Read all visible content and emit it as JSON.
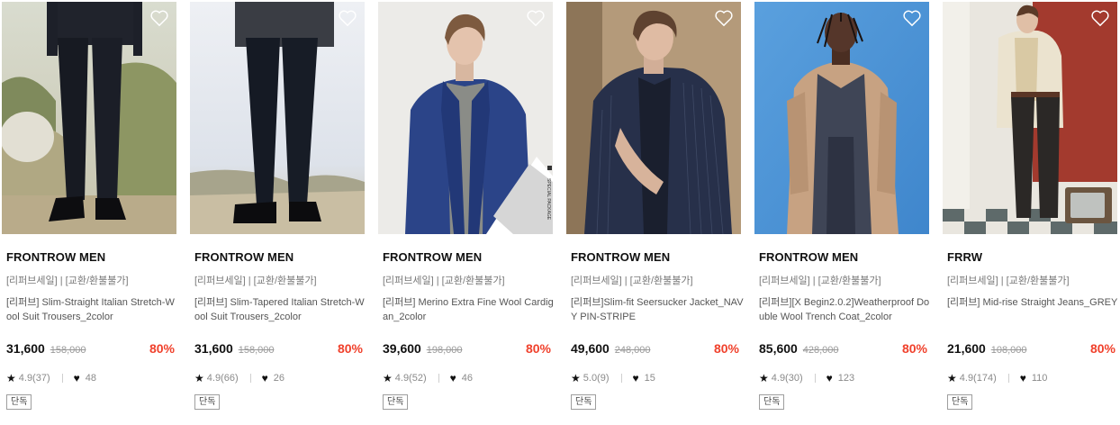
{
  "products": [
    {
      "brand": "FRONTROW MEN",
      "notice": "[리퍼브세일] | [교환/환불불가]",
      "name": "[리퍼브] Slim-Straight Italian Stretch-Wool Suit Trousers_2color",
      "price": "31,600",
      "original_price": "158,000",
      "discount": "80%",
      "rating": "4.9(37)",
      "likes": "48",
      "badge": "단독"
    },
    {
      "brand": "FRONTROW MEN",
      "notice": "[리퍼브세일] | [교환/환불불가]",
      "name": "[리퍼브] Slim-Tapered Italian Stretch-Wool Suit Trousers_2color",
      "price": "31,600",
      "original_price": "158,000",
      "discount": "80%",
      "rating": "4.9(66)",
      "likes": "26",
      "badge": "단독"
    },
    {
      "brand": "FRONTROW MEN",
      "notice": "[리퍼브세일] | [교환/환불불가]",
      "name": "[리퍼브] Merino Extra Fine Wool Cardigan_2color",
      "price": "39,600",
      "original_price": "198,000",
      "discount": "80%",
      "rating": "4.9(52)",
      "likes": "46",
      "badge": "단독",
      "package_label": "SPECIAL PACKAGE"
    },
    {
      "brand": "FRONTROW MEN",
      "notice": "[리퍼브세일] | [교환/환불불가]",
      "name": "[리퍼브]Slim-fit Seersucker Jacket_NAVY PIN-STRIPE",
      "price": "49,600",
      "original_price": "248,000",
      "discount": "80%",
      "rating": "5.0(9)",
      "likes": "15",
      "badge": "단독"
    },
    {
      "brand": "FRONTROW MEN",
      "notice": "[리퍼브세일] | [교환/환불불가]",
      "name": "[리퍼브][X Begin2.0.2]Weatherproof Double Wool Trench Coat_2color",
      "price": "85,600",
      "original_price": "428,000",
      "discount": "80%",
      "rating": "4.9(30)",
      "likes": "123",
      "badge": "단독"
    },
    {
      "brand": "FRRW",
      "notice": "[리퍼브세일] | [교환/환불불가]",
      "name": "[리퍼브] Mid-rise Straight Jeans_GREY",
      "price": "21,600",
      "original_price": "108,000",
      "discount": "80%",
      "rating": "4.9(174)",
      "likes": "110",
      "badge": "단독"
    }
  ],
  "icons": {
    "wishlist": "heart-outline-icon",
    "rating": "star-icon",
    "likes": "heart-filled-icon"
  },
  "colors": {
    "discount": "#f0412c",
    "text": "#111111",
    "muted": "#8a8a8a"
  }
}
